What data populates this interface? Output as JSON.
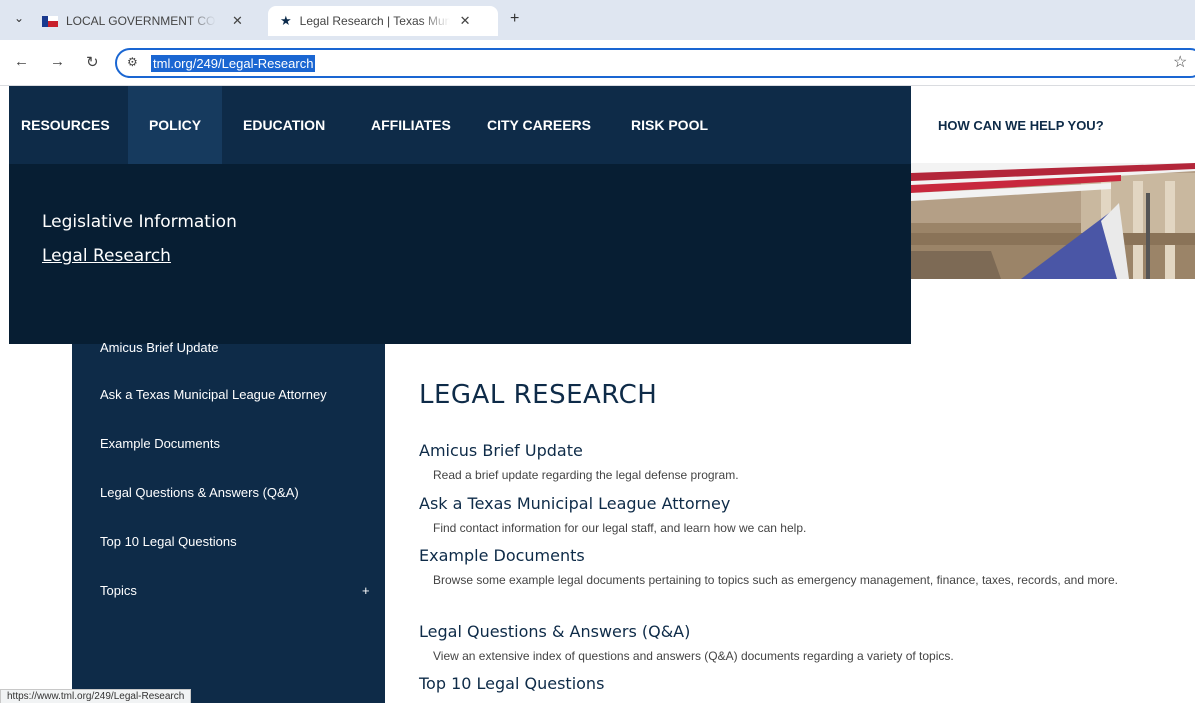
{
  "browser": {
    "tabs": [
      {
        "label": "LOCAL GOVERNMENT CODE CHAPTER"
      },
      {
        "label": "Legal Research | Texas Municipal League"
      }
    ],
    "url": "tml.org/249/Legal-Research"
  },
  "nav": {
    "items": [
      "RESOURCES",
      "POLICY",
      "EDUCATION",
      "AFFILIATES",
      "CITY CAREERS",
      "RISK POOL"
    ],
    "help": "HOW CAN WE HELP YOU?"
  },
  "dropdown": {
    "items": [
      "Legislative Information",
      "Legal Research"
    ]
  },
  "sidebar": {
    "items": [
      "Amicus Brief Update",
      "Ask a Texas Municipal League Attorney",
      "Example Documents",
      "Legal Questions & Answers (Q&A)",
      "Top 10 Legal Questions",
      "Topics"
    ],
    "expand_symbol": "+"
  },
  "main": {
    "title": "LEGAL RESEARCH",
    "entries": [
      {
        "title": "Amicus Brief Update",
        "desc": "Read a brief update regarding the legal defense program."
      },
      {
        "title": "Ask a Texas Municipal League Attorney",
        "desc": "Find contact information for our legal staff, and learn how we can help."
      },
      {
        "title": "Example Documents",
        "desc": "Browse some example legal documents pertaining to topics such as emergency management, finance, taxes, records, and more."
      },
      {
        "title": "Legal Questions & Answers (Q&A)",
        "desc": "View an extensive index of questions and answers (Q&A) documents regarding a variety of topics."
      },
      {
        "title": "Top 10 Legal Questions",
        "desc": ""
      }
    ]
  },
  "status_url": "https://www.tml.org/249/Legal-Research"
}
